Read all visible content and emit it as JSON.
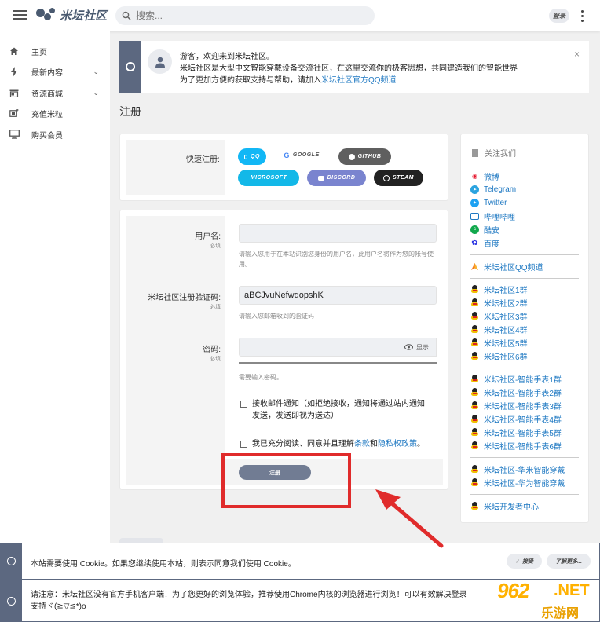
{
  "header": {
    "logo_text": "米坛社区",
    "search_placeholder": "搜索...",
    "login_label": "登录"
  },
  "sidebar": {
    "items": [
      {
        "label": "主页"
      },
      {
        "label": "最新内容"
      },
      {
        "label": "资源商城"
      },
      {
        "label": "充值米粒"
      },
      {
        "label": "购买会员"
      }
    ]
  },
  "notice": {
    "line1": "游客，欢迎来到米坛社区。",
    "line2": "米坛社区是大型中文智能穿戴设备交流社区，在这里交流你的极客思想，共同建造我们的智能世界",
    "line3_prefix": "为了更加方便的获取支持与帮助，请加入",
    "line3_link": "米坛社区官方QQ频道",
    "close": "×"
  },
  "page": {
    "title": "注册"
  },
  "quick_register": {
    "label": "快速注册:",
    "buttons": {
      "qq": "QQ",
      "google": "GOOGLE",
      "github": "GITHUB",
      "microsoft": "MICROSOFT",
      "discord": "DISCORD",
      "steam": "STEAM"
    }
  },
  "form": {
    "username": {
      "label": "用户名:",
      "required": "必填",
      "value": "",
      "hint": "请输入您用于在本站识别您身份的用户名，此用户名将作为您的帐号使用。"
    },
    "code": {
      "label": "米坛社区注册验证码:",
      "required": "必填",
      "value": "aBCJvuNefwdopshK",
      "hint": "请输入您邮箱收到的验证码"
    },
    "password": {
      "label": "密码:",
      "required": "必填",
      "value": "",
      "show_label": "显示",
      "hint": "需要输入密码。"
    },
    "email_notify": {
      "line1": "接收邮件通知（如拒绝接收，通知将通过站内通知",
      "line2": "发送，发送即视为送达）"
    },
    "agree": {
      "prefix": "我已充分阅读、同意并且理解",
      "terms": "条款",
      "and": "和",
      "privacy": "隐私权政策",
      "suffix": "。"
    },
    "submit": "注册"
  },
  "follow": {
    "title": "关注我们",
    "social": [
      {
        "label": "微博",
        "icon": "weibo-icon"
      },
      {
        "label": "Telegram",
        "icon": "telegram-icon"
      },
      {
        "label": "Twitter",
        "icon": "twitter-icon"
      },
      {
        "label": "哔哩哔哩",
        "icon": "bilibili-icon"
      },
      {
        "label": "酷安",
        "icon": "coolapk-icon"
      },
      {
        "label": "百度",
        "icon": "baidu-icon"
      }
    ],
    "channel": "米坛社区QQ频道",
    "groups": [
      "米坛社区1群",
      "米坛社区2群",
      "米坛社区3群",
      "米坛社区4群",
      "米坛社区5群",
      "米坛社区6群"
    ],
    "watch_groups": [
      "米坛社区-智能手表1群",
      "米坛社区-智能手表2群",
      "米坛社区-智能手表3群",
      "米坛社区-智能手表4群",
      "米坛社区-智能手表5群",
      "米坛社区-智能手表6群"
    ],
    "brand_groups": [
      "米坛社区-华米智能穿戴",
      "米坛社区-华为智能穿戴"
    ],
    "dev": "米坛开发者中心"
  },
  "cookie": {
    "message": "本站需要使用 Cookie。如果您继续使用本站，则表示同意我们使用 Cookie。",
    "accept": "接受",
    "learn_more": "了解更多..."
  },
  "bottom_notice": {
    "line1": "请注意：米坛社区没有官方手机客户端！为了您更好的浏览体验，推荐使用Chrome内核的浏览器进行浏览！可以有效解决登录",
    "line2": "支持ヾ(≧▽≦*)o"
  },
  "watermark": {
    "number": "962",
    "net": ".NET",
    "cn": "乐游网"
  },
  "colors": {
    "accent": "#5c6880",
    "link": "#1e78c2",
    "qq": "#12b7f5",
    "google": "#ffffff",
    "github": "#5f5f5f",
    "microsoft": "#13b8e8",
    "discord": "#7a84cf",
    "steam": "#222222",
    "highlight": "#e02b2b"
  }
}
